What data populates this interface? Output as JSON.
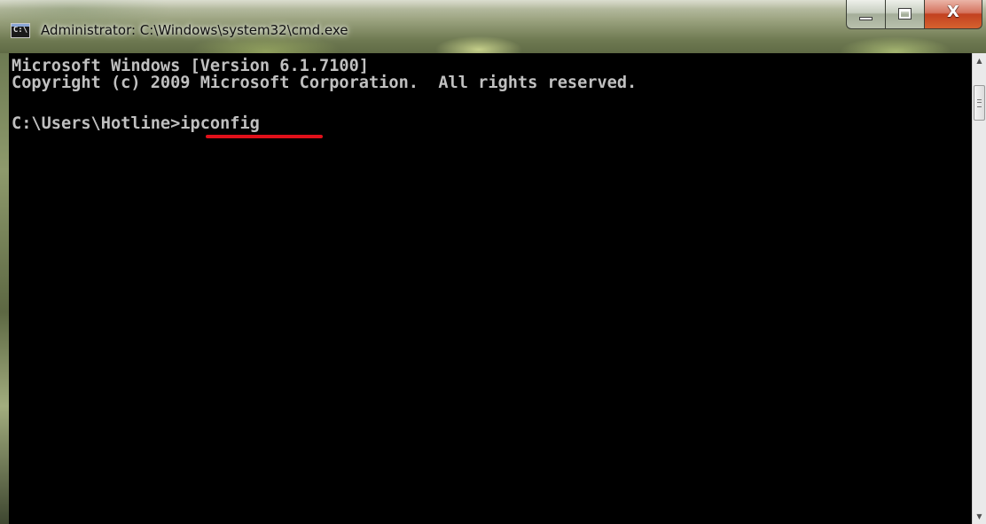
{
  "window": {
    "title": "Administrator: C:\\Windows\\system32\\cmd.exe",
    "app_icon_text": "C:\\",
    "close_glyph": "X"
  },
  "console": {
    "lines": [
      "Microsoft Windows [Version 6.1.7100]",
      "Copyright (c) 2009 Microsoft Corporation.  All rights reserved.",
      "",
      "C:\\Users\\Hotline>ipconfig"
    ],
    "text_color": "#c0c0c0",
    "background_color": "#000000",
    "highlight_underline_color": "#e0101a"
  },
  "scrollbar": {
    "up_arrow": "▲",
    "down_arrow": "▼"
  }
}
